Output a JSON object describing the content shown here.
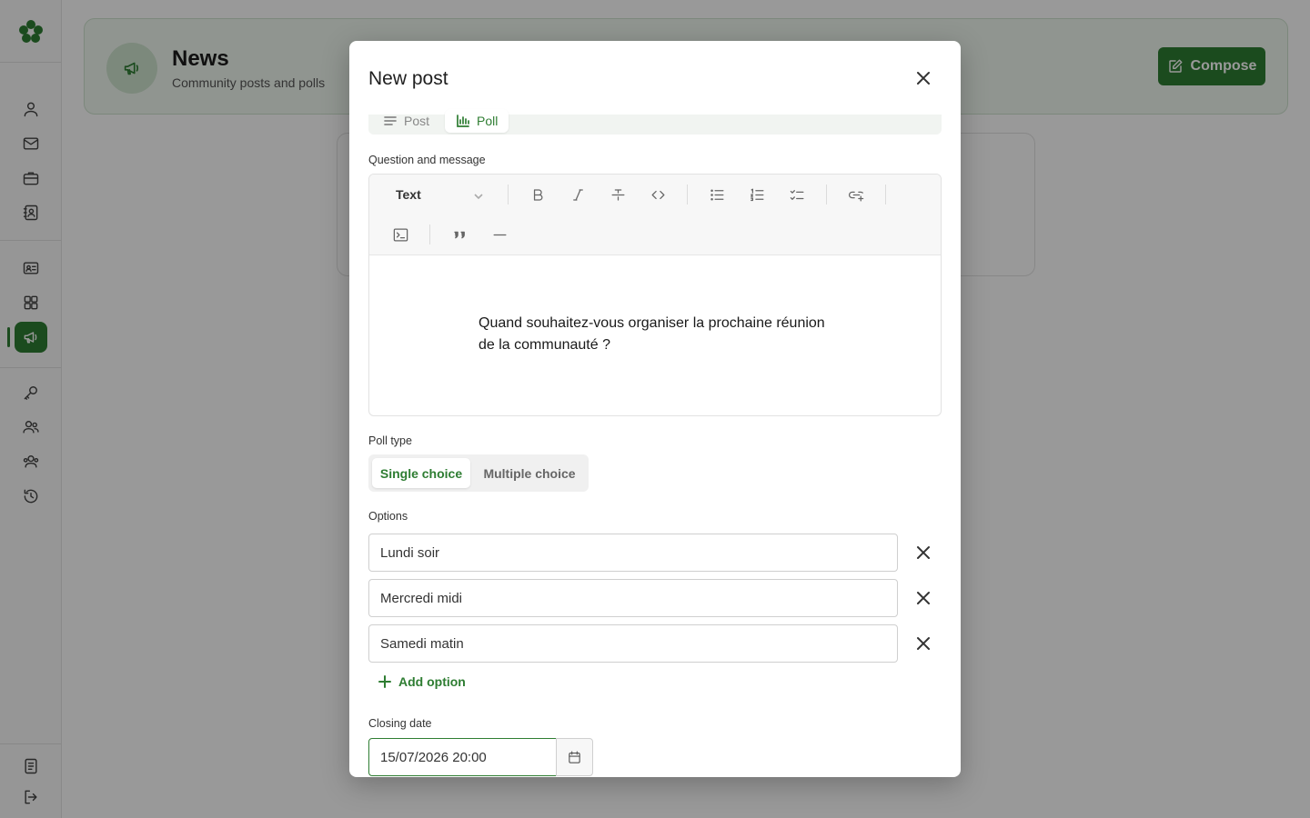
{
  "header": {
    "title": "News",
    "subtitle": "Community posts and polls",
    "compose_label": "Compose"
  },
  "sidebar": {
    "items": [
      {
        "icon": "user-icon"
      },
      {
        "icon": "mail-icon"
      },
      {
        "icon": "briefcase-icon"
      },
      {
        "icon": "contact-book-icon"
      },
      {
        "icon": "id-card-icon"
      },
      {
        "icon": "grid-icon"
      },
      {
        "icon": "megaphone-icon",
        "active": true
      },
      {
        "icon": "key-icon"
      },
      {
        "icon": "users-icon"
      },
      {
        "icon": "group-icon"
      },
      {
        "icon": "history-icon"
      },
      {
        "icon": "document-icon"
      },
      {
        "icon": "logout-icon"
      }
    ]
  },
  "modal": {
    "title": "New post",
    "tabs": [
      {
        "label": "Post",
        "active": false
      },
      {
        "label": "Poll",
        "active": true
      }
    ],
    "message_label": "Question and message",
    "editor": {
      "block_type": "Text",
      "content": "Quand souhaitez-vous organiser la prochaine réunion de la communauté ?"
    },
    "poll_type_label": "Poll type",
    "poll_types": [
      {
        "label": "Single choice",
        "selected": true
      },
      {
        "label": "Multiple choice",
        "selected": false
      }
    ],
    "options_label": "Options",
    "options": [
      "Lundi soir",
      "Mercredi midi",
      "Samedi matin"
    ],
    "add_option_label": "Add option",
    "closing_date_label": "Closing date",
    "closing_date_value": "15/07/2026 20:00"
  },
  "colors": {
    "accent": "#2e7d32",
    "header_bg": "#f1f8f1"
  }
}
